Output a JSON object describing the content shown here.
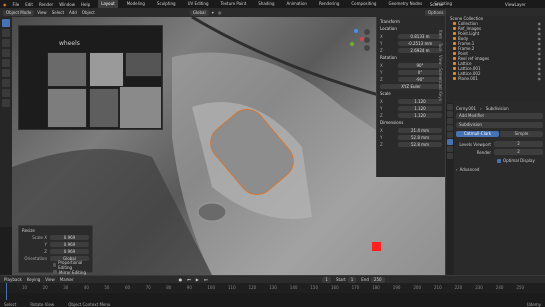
{
  "menubar": {
    "menus": [
      "File",
      "Edit",
      "Render",
      "Window",
      "Help"
    ],
    "workspaces": [
      "Layout",
      "Modeling",
      "Sculpting",
      "UV Editing",
      "Texture Paint",
      "Shading",
      "Animation",
      "Rendering",
      "Compositing",
      "Geometry Nodes",
      "Scripting"
    ],
    "active_workspace": "Layout",
    "scene": "Scene",
    "view_layer": "ViewLayer"
  },
  "header": {
    "mode": "Object Mode",
    "menus": [
      "View",
      "Select",
      "Add",
      "Object"
    ],
    "orientation": "Global",
    "options": "Options"
  },
  "image_panel": {
    "label": "wheels"
  },
  "npanel": {
    "title": "Transform",
    "location_label": "Location",
    "location": [
      {
        "axis": "X",
        "value": "0.8133 m"
      },
      {
        "axis": "Y",
        "value": "-0.2513 mm"
      },
      {
        "axis": "Z",
        "value": "2.6924 m"
      }
    ],
    "rotation_label": "Rotation",
    "rotation": [
      {
        "axis": "X",
        "value": "90°"
      },
      {
        "axis": "Y",
        "value": "0°"
      },
      {
        "axis": "Z",
        "value": "-90°"
      }
    ],
    "rotation_mode": "XYZ Euler",
    "scale_label": "Scale",
    "scale": [
      {
        "axis": "X",
        "value": "1.120"
      },
      {
        "axis": "Y",
        "value": "1.120"
      },
      {
        "axis": "Z",
        "value": "1.120"
      }
    ],
    "dimensions_label": "Dimensions",
    "dimensions": [
      {
        "axis": "X",
        "value": "21.4 mm"
      },
      {
        "axis": "Y",
        "value": "52.8 mm"
      },
      {
        "axis": "Z",
        "value": "52.8 mm"
      }
    ],
    "side_tabs": [
      "Item",
      "Tool",
      "View",
      "Screencast Keys"
    ]
  },
  "redo_panel": {
    "title": "Resize",
    "rows": [
      {
        "label": "Scale X",
        "value": "0.969"
      },
      {
        "label": "Y",
        "value": "0.969"
      },
      {
        "label": "Z",
        "value": "0.969"
      }
    ],
    "orientation_label": "Orientation",
    "orientation_value": "Global",
    "proportional": "Proportional Editing",
    "mirror": "Mirror Editing"
  },
  "outliner": {
    "title": "Scene Collection",
    "items": [
      "Collection",
      "Ref_Images",
      "Point.Light",
      "Body",
      "Frame.1",
      "Frame.2",
      "Point",
      "Reel ref images",
      "Lattice",
      "Lattice.001",
      "Lattice.002",
      "Plane.001"
    ]
  },
  "properties": {
    "object_name": "Cerny.001",
    "modifier_name": "Subdivision",
    "add_modifier": "Add Modifier",
    "mode_catmull": "Catmull-Clark",
    "mode_simple": "Simple",
    "levels_viewport_label": "Levels Viewport",
    "levels_viewport": "2",
    "render_label": "Render",
    "render": "2",
    "optimal_display": "Optimal Display",
    "advanced": "Advanced"
  },
  "timeline": {
    "menus": [
      "Playback",
      "Keying",
      "View",
      "Marker"
    ],
    "current_frame": "1",
    "start_label": "Start",
    "start": "1",
    "end_label": "End",
    "end": "250",
    "ticks": [
      "10",
      "20",
      "30",
      "40",
      "50",
      "60",
      "70",
      "80",
      "90",
      "100",
      "110",
      "120",
      "130",
      "140",
      "150",
      "160",
      "170",
      "180",
      "190",
      "200",
      "210",
      "220",
      "230",
      "240",
      "250"
    ]
  },
  "status": {
    "select": "Select",
    "rotate": "Rotate View",
    "context": "Object Context Menu",
    "watermark": "Udemy"
  }
}
